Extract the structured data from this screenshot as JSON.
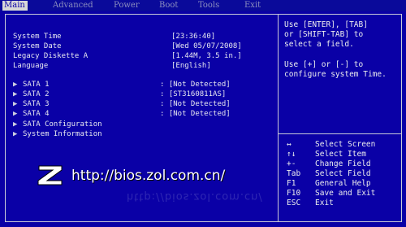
{
  "menu": {
    "items": [
      "Main",
      "Advanced",
      "Power",
      "Boot",
      "Tools",
      "Exit"
    ]
  },
  "main": {
    "system_time_label": "System Time",
    "system_time_value": "[23:36:40]",
    "system_date_label": "System Date",
    "system_date_value": "[Wed 05/07/2008]",
    "legacy_diskette_label": "Legacy Diskette A",
    "legacy_diskette_value": "[1.44M, 3.5 in.]",
    "language_label": "Language",
    "language_value": "[English]",
    "sata1_label": "SATA 1",
    "sata1_value": ": [Not Detected]",
    "sata2_label": "SATA 2",
    "sata2_value": ": [ST3160811AS]",
    "sata3_label": "SATA 3",
    "sata3_value": ": [Not Detected]",
    "sata4_label": "SATA 4",
    "sata4_value": ": [Not Detected]",
    "sata_config_label": "SATA Configuration",
    "system_info_label": "System Information"
  },
  "help": {
    "line1": "Use [ENTER], [TAB]",
    "line2": "or [SHIFT-TAB] to",
    "line3": "select a field.",
    "line4": "Use [+] or [-] to",
    "line5": "configure system Time."
  },
  "keys": [
    {
      "key": "↔",
      "action": "Select Screen"
    },
    {
      "key": "↑↓",
      "action": "Select Item"
    },
    {
      "key": "+-",
      "action": "Change Field"
    },
    {
      "key": "Tab",
      "action": "Select Field"
    },
    {
      "key": "F1",
      "action": "General Help"
    },
    {
      "key": "F10",
      "action": "Save and Exit"
    },
    {
      "key": "ESC",
      "action": "Exit"
    }
  ],
  "watermark": {
    "logo_letter": "Z",
    "url": "http://bios.zol.com.cn/"
  },
  "colors": {
    "background": "#0a00a6",
    "text": "#e8e8f0",
    "menu_active_bg": "#d8d8d8"
  }
}
